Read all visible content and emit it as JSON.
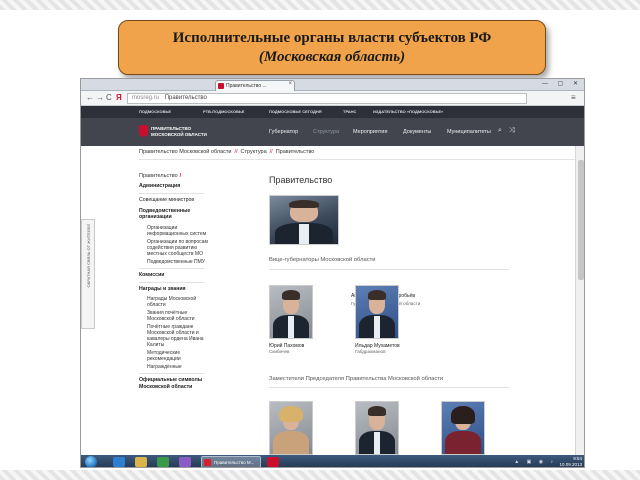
{
  "slide": {
    "title_line1": "Исполнительные органы власти субъектов РФ",
    "title_line2": "(Московская область)"
  },
  "browser": {
    "tab_title": "Правительство ...",
    "tab_close": "×",
    "window_buttons": "— ▢ ✕",
    "back": "←",
    "forward": "→",
    "refresh": "C",
    "yandex": "Я",
    "url_domain": "mosreg.ru",
    "url_title": "Правительство",
    "menu_icon": "≡"
  },
  "topnav": [
    "ПОДМОСКОВЬЕ",
    "РТВ-ПОДМОСКОВЬЕ",
    "ПОДМОСКОВЬЕ СЕГОДНЯ",
    "ТРАНС",
    "ИЗДАТЕЛЬСТВО «ПОДМОСКОВЬЕ»"
  ],
  "header": {
    "logo_text": "ПРАВИТЕЛЬСТВО\nМОСКОВСКОЙ ОБЛАСТИ",
    "menu": [
      "Губернатор",
      "Структура",
      "Мероприятия",
      "Документы",
      "Муниципалитеты"
    ],
    "search_icon": "⌕",
    "share_icon": "⤨"
  },
  "breadcrumbs": [
    "Правительство Московской области",
    "Структура",
    "Правительство"
  ],
  "breadcrumb_sep": "//",
  "side_tab": "ОБРАТНАЯ СВЯЗЬ ОТ ЖИТЕЛЕЙ",
  "sidebar": {
    "heading": "Правительство",
    "heading_slash": "/",
    "items": [
      {
        "label": "Администрация",
        "bold": true
      },
      {
        "label": "Совещание министров"
      },
      {
        "label": "Подведомственные организации",
        "bold": true
      }
    ],
    "sub_org": [
      "Организации информационных систем",
      "Организации по вопросам содействия развитию местных сообществ МО",
      "Подведомственные ПМУ"
    ],
    "item_commission": "Комиссии",
    "item_awards": "Награды и звания",
    "sub_awards": [
      "Награды Московской области",
      "Звания почётные Московской области",
      "Почётные граждане Московской области и кавалеры ордена Ивана Калиты",
      "Методические рекомендации",
      "Награждённые"
    ],
    "item_symbols": "Официальные символы Московской области"
  },
  "main": {
    "page_title": "Правительство",
    "governor_name": "Андрей Юрьевич Воробьёв",
    "governor_role": "Губернатор Московской области",
    "vice_title": "Вице-губернаторы Московской области",
    "vice": [
      {
        "name": "Юрий Пахомов",
        "role": "Скибичев"
      },
      {
        "name": "Ильдар Мухаметов",
        "role": "Габдрахманов"
      }
    ],
    "deputies_title": "Заместители Председателя Правительства Московской области"
  },
  "taskbar": {
    "task_label": "Правительство М...",
    "time": "9:54",
    "date": "10.09.2013",
    "tray_icons": "▲ ▣ ◉ ♪"
  }
}
